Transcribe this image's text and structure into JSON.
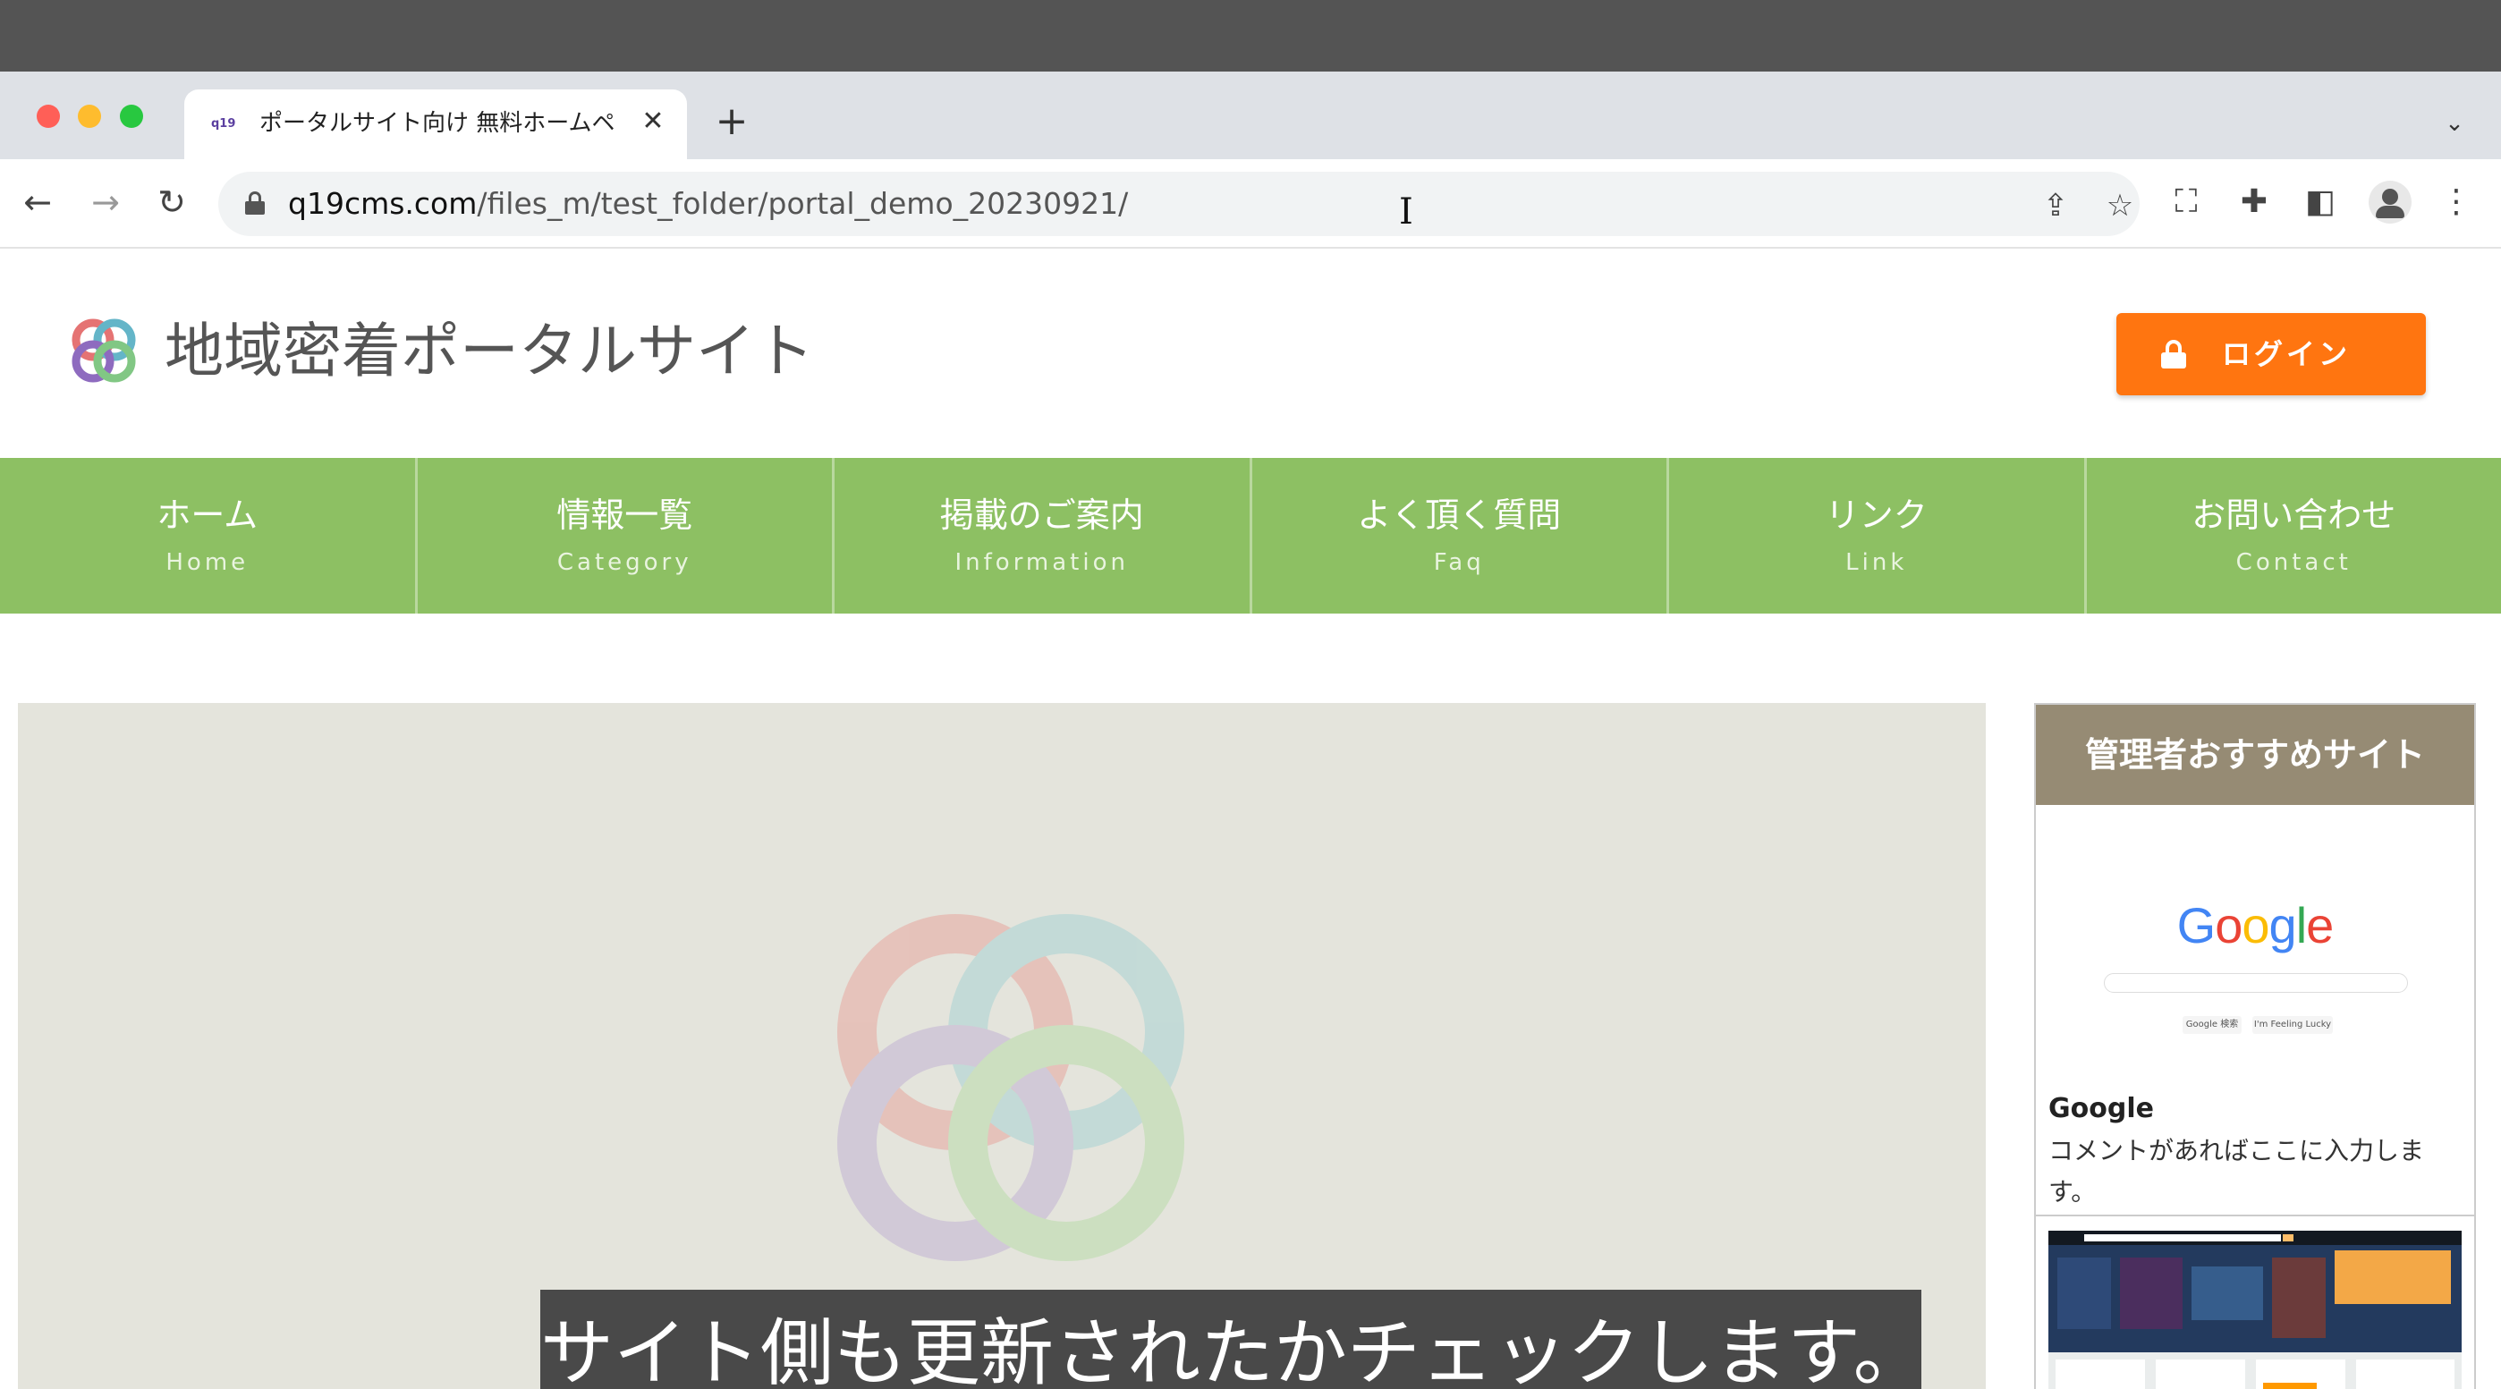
{
  "browser": {
    "tab_title": "ポータルサイト向け 無料ホームペ",
    "tab_favicon_text": "q19",
    "url_host": "q19cms.com",
    "url_path": "/files_m/test_folder/portal_demo_20230921/",
    "icons": [
      "back-icon",
      "forward-icon",
      "reload-icon",
      "lock-icon",
      "share-icon",
      "star-icon",
      "screenshot-icon",
      "extensions-icon",
      "sidepanel-icon",
      "profile-icon",
      "menu-icon"
    ]
  },
  "site": {
    "title": "地域密着ポータルサイト",
    "login_label": "ログイン"
  },
  "nav": {
    "items": [
      {
        "jp": "ホーム",
        "en": "Home"
      },
      {
        "jp": "情報一覧",
        "en": "Category"
      },
      {
        "jp": "掲載のご案内",
        "en": "Information"
      },
      {
        "jp": "よく頂く質問",
        "en": "Faq"
      },
      {
        "jp": "リンク",
        "en": "Link"
      },
      {
        "jp": "お問い合わせ",
        "en": "Contact"
      }
    ]
  },
  "sidebar": {
    "heading": "管理者おすすめサイト",
    "cards": [
      {
        "title": "Google",
        "comment": "コメントがあればここに入力します。",
        "thumb_logo": "Google",
        "thumb_buttons": [
          "Google 検索",
          "I'm Feeling Lucky"
        ]
      }
    ]
  },
  "caption": {
    "text": "サイト側も更新されたかチェックします。"
  },
  "colors": {
    "nav_green": "#8dc063",
    "login_orange": "#ff7510",
    "sidebar_head": "#968b74"
  }
}
